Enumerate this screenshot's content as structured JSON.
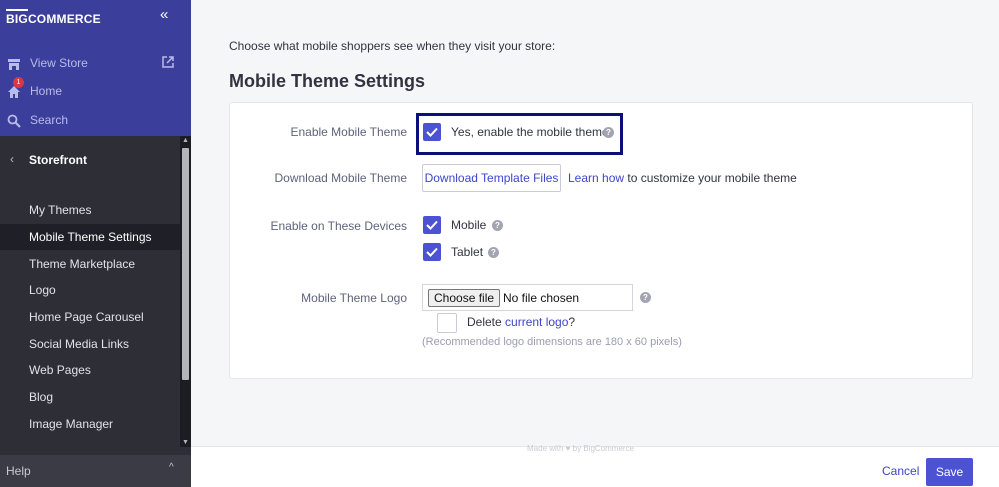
{
  "brand": {
    "logo_big": "BIG",
    "logo_rest": "COMMERCE"
  },
  "sidebar": {
    "collapse_icon": "double-chevron-left",
    "top_links": [
      {
        "label": "View Store",
        "icon": "store-icon",
        "external_icon": "external-link-icon"
      },
      {
        "label": "Home",
        "icon": "home-icon",
        "badge": "1"
      },
      {
        "label": "Search",
        "icon": "search-icon"
      }
    ],
    "section": {
      "chevron": "‹",
      "label": "Storefront"
    },
    "items": [
      {
        "label": "My Themes"
      },
      {
        "label": "Mobile Theme Settings",
        "active": true
      },
      {
        "label": "Theme Marketplace"
      },
      {
        "label": "Logo"
      },
      {
        "label": "Home Page Carousel"
      },
      {
        "label": "Social Media Links"
      },
      {
        "label": "Web Pages"
      },
      {
        "label": "Blog"
      },
      {
        "label": "Image Manager"
      }
    ],
    "help": {
      "label": "Help",
      "caret": "^"
    }
  },
  "main": {
    "intro": "Choose what mobile shoppers see when they visit your store:",
    "heading": "Mobile Theme Settings",
    "enable_theme": {
      "label": "Enable Mobile Theme",
      "checkbox_label": "Yes, enable the mobile theme",
      "checked": true
    },
    "download": {
      "label": "Download Mobile Theme",
      "button": "Download Template Files",
      "link_text": "Learn how",
      "after_link": "to customize your mobile theme"
    },
    "devices": {
      "label": "Enable on These Devices",
      "options": [
        {
          "label": "Mobile",
          "checked": true
        },
        {
          "label": "Tablet",
          "checked": true
        }
      ]
    },
    "logo": {
      "label": "Mobile Theme Logo",
      "choose_button": "Choose file",
      "no_file": "No file chosen",
      "delete_prefix": "Delete",
      "delete_link": "current logo",
      "delete_suffix": "?",
      "hint": "(Recommended logo dimensions are 180 x 60 pixels)"
    },
    "help_glyph": "?"
  },
  "footer": {
    "faint_text": "Made with ♥ by BigCommerce",
    "cancel": "Cancel",
    "save": "Save"
  },
  "colors": {
    "sidebar_top": "#3c3e9c",
    "sidebar": "#2d2e36",
    "accent": "#4c53d2",
    "link": "#3c46c9",
    "highlight": "#0b0f7a"
  }
}
